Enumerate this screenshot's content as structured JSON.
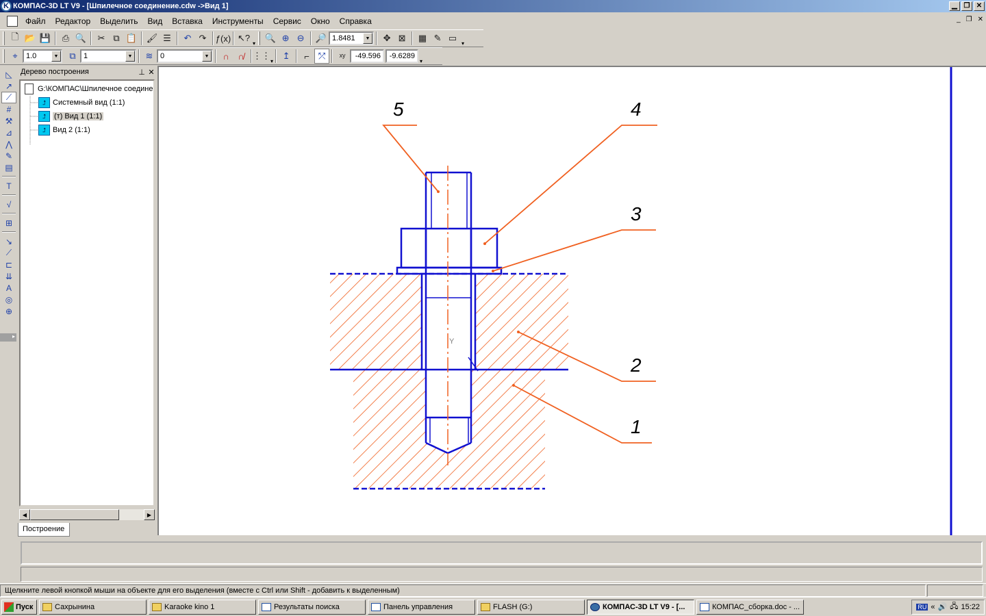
{
  "window": {
    "app_icon_glyph": "K",
    "title": "КОМПАС-3D LT V9 - [Шпилечное соединение.cdw ->Вид 1]",
    "minimize_icon": "minimize-icon",
    "restore_icon": "restore-icon",
    "close_icon": "close-icon"
  },
  "menu": {
    "items": [
      "Файл",
      "Редактор",
      "Выделить",
      "Вид",
      "Вставка",
      "Инструменты",
      "Сервис",
      "Окно",
      "Справка"
    ]
  },
  "toolbar_standard": {
    "zoom_value": "1.8481"
  },
  "toolbar_current_state": {
    "step_value": "1.0",
    "view_value": "1",
    "layer_value": "0",
    "coord_x": "-49.596",
    "coord_y": "-9.6289"
  },
  "tree": {
    "title": "Дерево построения",
    "root": "G:\\КОМПАС\\Шпилечное соединение",
    "items": [
      "Системный вид (1:1)",
      "(т) Вид 1 (1:1)",
      "Вид 2 (1:1)"
    ],
    "tab_label": "Построение"
  },
  "drawing": {
    "callouts": [
      "5",
      "4",
      "3",
      "2",
      "1"
    ],
    "axis_label": "Y",
    "colors": {
      "contour": "#1010d0",
      "hatch": "#f06020"
    }
  },
  "status": {
    "message": "Щелкните левой кнопкой мыши на объекте для его выделения (вместе с Ctrl или Shift - добавить к выделенным)"
  },
  "taskbar": {
    "start_label": "Пуск",
    "buttons": [
      "Сахрынина",
      "Karaoke kino 1",
      "Результаты поиска",
      "Панель управления",
      "FLASH (G:)",
      "КОМПАС-3D LT V9 - [...",
      "КОМПАС_сборка.doc - ..."
    ],
    "active_index": 5,
    "lang": "RU",
    "clock": "15:22"
  }
}
